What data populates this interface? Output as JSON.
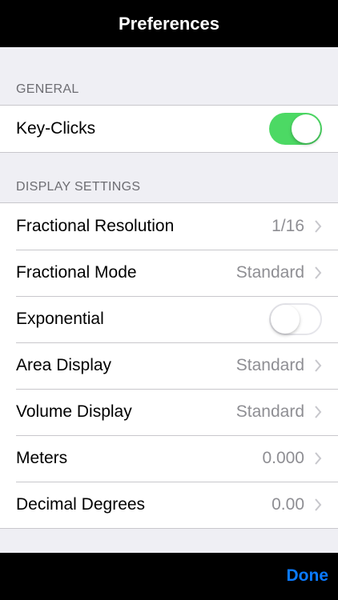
{
  "header": {
    "title": "Preferences"
  },
  "colors": {
    "accent": "#0a7aff",
    "toggle_on": "#4cd964",
    "secondary_text": "#8e8e93",
    "section_text": "#6d6d72"
  },
  "general": {
    "header": "GENERAL",
    "key_clicks": {
      "label": "Key-Clicks",
      "enabled": true
    }
  },
  "display_settings": {
    "header": "DISPLAY SETTINGS",
    "rows": [
      {
        "label": "Fractional Resolution",
        "value": "1/16",
        "icon": "chevron-right-icon"
      },
      {
        "label": "Fractional Mode",
        "value": "Standard",
        "icon": "chevron-right-icon"
      },
      {
        "label": "Exponential",
        "toggle": true,
        "enabled": false
      },
      {
        "label": "Area Display",
        "value": "Standard",
        "icon": "chevron-right-icon"
      },
      {
        "label": "Volume Display",
        "value": "Standard",
        "icon": "chevron-right-icon"
      },
      {
        "label": "Meters",
        "value": "0.000",
        "icon": "chevron-right-icon"
      },
      {
        "label": "Decimal Degrees",
        "value": "0.00",
        "icon": "chevron-right-icon"
      }
    ]
  },
  "footer": {
    "done_label": "Done"
  }
}
